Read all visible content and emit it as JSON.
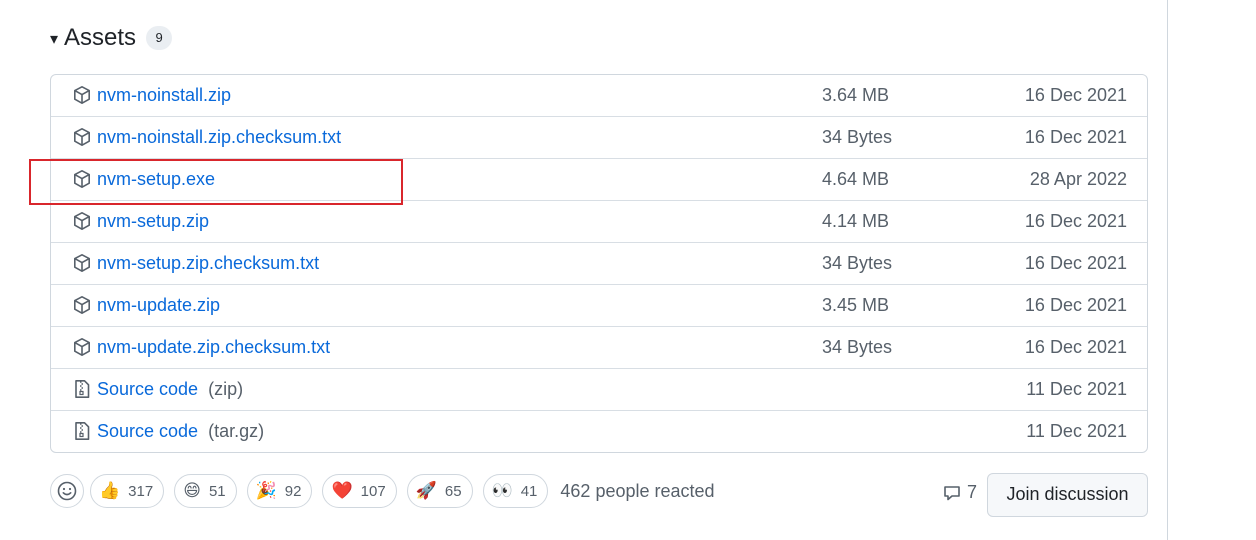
{
  "assets": {
    "caret": "▾",
    "title": "Assets",
    "count": "9",
    "rows": [
      {
        "name": "nvm-noinstall.zip",
        "suffix": "",
        "size": "3.64 MB",
        "date": "16 Dec 2021",
        "icon": "package-icon"
      },
      {
        "name": "nvm-noinstall.zip.checksum.txt",
        "suffix": "",
        "size": "34 Bytes",
        "date": "16 Dec 2021",
        "icon": "package-icon"
      },
      {
        "name": "nvm-setup.exe",
        "suffix": "",
        "size": "4.64 MB",
        "date": "28 Apr 2022",
        "icon": "package-icon"
      },
      {
        "name": "nvm-setup.zip",
        "suffix": "",
        "size": "4.14 MB",
        "date": "16 Dec 2021",
        "icon": "package-icon"
      },
      {
        "name": "nvm-setup.zip.checksum.txt",
        "suffix": "",
        "size": "34 Bytes",
        "date": "16 Dec 2021",
        "icon": "package-icon"
      },
      {
        "name": "nvm-update.zip",
        "suffix": "",
        "size": "3.45 MB",
        "date": "16 Dec 2021",
        "icon": "package-icon"
      },
      {
        "name": "nvm-update.zip.checksum.txt",
        "suffix": "",
        "size": "34 Bytes",
        "date": "16 Dec 2021",
        "icon": "package-icon"
      },
      {
        "name": "Source code",
        "suffix": "(zip)",
        "size": "",
        "date": "11 Dec 2021",
        "icon": "file-zip-icon"
      },
      {
        "name": "Source code",
        "suffix": "(tar.gz)",
        "size": "",
        "date": "11 Dec 2021",
        "icon": "file-zip-icon"
      }
    ]
  },
  "reactions": {
    "items": [
      {
        "emoji": "👍",
        "count": "317",
        "icon": "thumbs-up-icon"
      },
      {
        "emoji": "😄",
        "count": "51",
        "icon": "smile-icon"
      },
      {
        "emoji": "🎉",
        "count": "92",
        "icon": "tada-icon"
      },
      {
        "emoji": "❤️",
        "count": "107",
        "icon": "heart-icon"
      },
      {
        "emoji": "🚀",
        "count": "65",
        "icon": "rocket-icon"
      },
      {
        "emoji": "👀",
        "count": "41",
        "icon": "eyes-icon"
      }
    ],
    "summary": "462 people reacted"
  },
  "discussion": {
    "comment_count": "7",
    "join_label": "Join discussion"
  },
  "colors": {
    "link": "#0969da",
    "muted": "#57606a",
    "highlight": "#d9262c"
  }
}
